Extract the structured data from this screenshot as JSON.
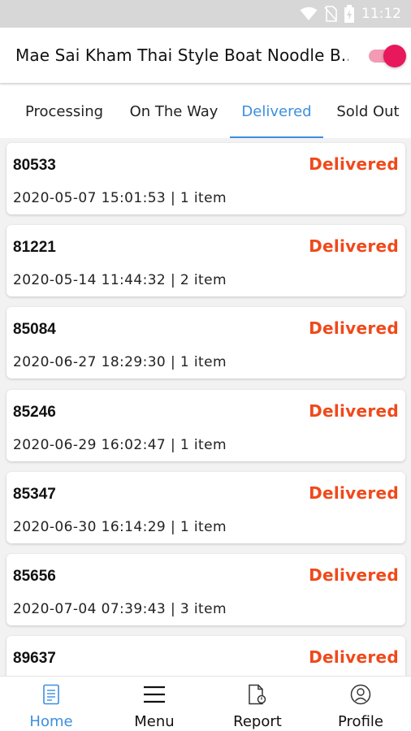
{
  "status_bar": {
    "time": "11:12"
  },
  "app_bar": {
    "title": "Mae Sai Kham Thai Style Boat Noodle B..",
    "toggle_on": true,
    "toggle_color": "#e8185c"
  },
  "tabs": [
    {
      "label": "Processing",
      "active": false
    },
    {
      "label": "On The Way",
      "active": false
    },
    {
      "label": "Delivered",
      "active": true
    },
    {
      "label": "Sold Out",
      "active": false
    }
  ],
  "orders": [
    {
      "id": "80533",
      "status": "Delivered",
      "meta": "2020-05-07 15:01:53 | 1 item"
    },
    {
      "id": "81221",
      "status": "Delivered",
      "meta": "2020-05-14 11:44:32 | 2 item"
    },
    {
      "id": "85084",
      "status": "Delivered",
      "meta": "2020-06-27 18:29:30 | 1 item"
    },
    {
      "id": "85246",
      "status": "Delivered",
      "meta": "2020-06-29 16:02:47 | 1 item"
    },
    {
      "id": "85347",
      "status": "Delivered",
      "meta": "2020-06-30 16:14:29 | 1 item"
    },
    {
      "id": "85656",
      "status": "Delivered",
      "meta": "2020-07-04 07:39:43 | 3 item"
    },
    {
      "id": "89637",
      "status": "Delivered",
      "meta": ""
    }
  ],
  "bottom_nav": [
    {
      "label": "Home",
      "icon": "home-document-icon",
      "active": true
    },
    {
      "label": "Menu",
      "icon": "hamburger-menu-icon",
      "active": false
    },
    {
      "label": "Report",
      "icon": "report-document-icon",
      "active": false
    },
    {
      "label": "Profile",
      "icon": "profile-icon",
      "active": false
    }
  ],
  "colors": {
    "accent": "#3c8fe0",
    "status_delivered": "#f0491b"
  }
}
